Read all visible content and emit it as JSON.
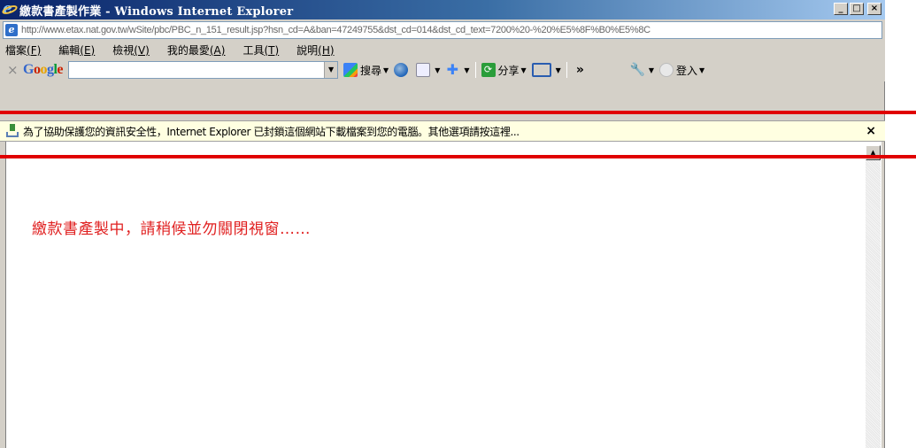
{
  "window": {
    "title": "繳款書產製作業 - Windows Internet Explorer",
    "buttons": {
      "minimize": "_",
      "maximize": "□",
      "close": "×"
    }
  },
  "address": {
    "url": "http://www.etax.nat.gov.tw/wSite/pbc/PBC_n_151_result.jsp?hsn_cd=A&ban=47249755&dst_cd=014&dst_cd_text=7200%20-%20%E5%8F%B0%E5%8C"
  },
  "menu": {
    "items": [
      {
        "label": "檔案",
        "key": "(F)"
      },
      {
        "label": "編輯",
        "key": "(E)"
      },
      {
        "label": "檢視",
        "key": "(V)"
      },
      {
        "label": "我的最愛",
        "key": "(A)"
      },
      {
        "label": "工具",
        "key": "(T)"
      },
      {
        "label": "說明",
        "key": "(H)"
      }
    ]
  },
  "google_toolbar": {
    "close_label": "×",
    "logo": [
      "G",
      "o",
      "o",
      "g",
      "l",
      "e"
    ],
    "search_label": "搜尋",
    "share_label": "分享",
    "more_label": "»",
    "signin_label": "登入"
  },
  "infobar": {
    "text": "為了協助保護您的資訊安全性，Internet Explorer 已封鎖這個網站下載檔案到您的電腦。其他選項請按這裡...",
    "close": "×"
  },
  "content": {
    "message": "繳款書產製中，請稍候並勿關閉視窗……"
  },
  "colors": {
    "annotation_red": "#e00000",
    "message_red": "#e02020",
    "infobar_bg": "#ffffe1"
  }
}
